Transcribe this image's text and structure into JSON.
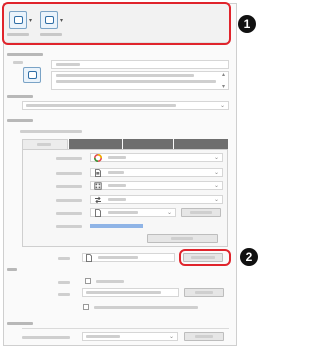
{
  "callouts": [
    {
      "number": "1"
    },
    {
      "number": "2"
    }
  ],
  "ribbon": {
    "buttons": [
      {
        "icon": "window-icon",
        "dropdown": "▾"
      },
      {
        "icon": "window-icon",
        "dropdown": "▾"
      }
    ]
  },
  "rows": {
    "color_icon": "color-wheel-icon",
    "paper_icon": "paper-icon",
    "grid_icon": "grid-icon",
    "swap_icon": "swap-icon",
    "file_icon": "file-icon"
  },
  "glyphs": {
    "chevron": "⌄",
    "scroll_up": "▴",
    "scroll_down": "▾"
  },
  "colors": {
    "callout_outline": "#e0242c",
    "badge": "#111111",
    "accent_bar": "#8fb4e6",
    "tab_dark": "#6e6e6e"
  }
}
